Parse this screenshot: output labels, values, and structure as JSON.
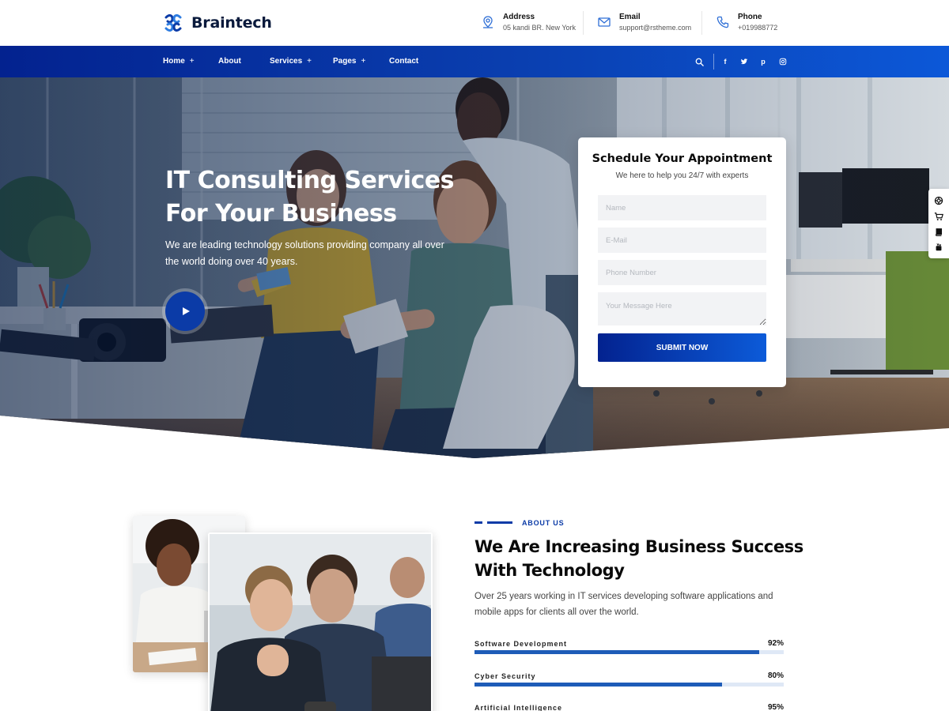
{
  "brand": {
    "name": "Braintech",
    "color": "#0a1a3c",
    "accent": "#0b3ba7"
  },
  "header": {
    "contacts": [
      {
        "icon": "location-icon",
        "title": "Address",
        "value": "05 kandi BR. New York"
      },
      {
        "icon": "email-icon",
        "title": "Email",
        "value": "support@rstheme.com"
      },
      {
        "icon": "phone-icon",
        "title": "Phone",
        "value": "+019988772"
      }
    ]
  },
  "nav": {
    "items": [
      {
        "label": "Home",
        "has_submenu": true
      },
      {
        "label": "About",
        "has_submenu": false
      },
      {
        "label": "Services",
        "has_submenu": true
      },
      {
        "label": "Pages",
        "has_submenu": true
      },
      {
        "label": "Contact",
        "has_submenu": false
      }
    ],
    "submenu_marker": "+",
    "right_icons": [
      "search-icon",
      "facebook-icon",
      "twitter-icon",
      "pinterest-icon",
      "instagram-icon"
    ],
    "social_glyphs": {
      "facebook": "f",
      "pinterest": "p"
    }
  },
  "hero": {
    "title_line1": "IT Consulting Services",
    "title_line2": "For Your Business",
    "description": "We are leading technology solutions providing company all over the world doing over 40 years.",
    "play_icon": "play-icon"
  },
  "appointment": {
    "title": "Schedule Your Appointment",
    "subtitle": "We here to help you 24/7 with experts",
    "fields": {
      "name_placeholder": "Name",
      "email_placeholder": "E-Mail",
      "phone_placeholder": "Phone Number",
      "message_placeholder": "Your Message Here"
    },
    "submit_label": "Submit Now"
  },
  "side_tools": [
    "lifebuoy-icon",
    "cart-icon",
    "book-icon",
    "youtube-icon"
  ],
  "about": {
    "subtitle": "ABOUT US",
    "title_line1": "We Are Increasing Business Success",
    "title_line2": "With Technology",
    "description": "Over 25 years working in IT services developing software applications and mobile apps for clients all over the world.",
    "skills": [
      {
        "label": "Software Development",
        "percent": 92,
        "percent_label": "92%"
      },
      {
        "label": "Cyber Security",
        "percent": 80,
        "percent_label": "80%"
      },
      {
        "label": "Artificial Intelligence",
        "percent": 95,
        "percent_label": "95%"
      }
    ]
  }
}
